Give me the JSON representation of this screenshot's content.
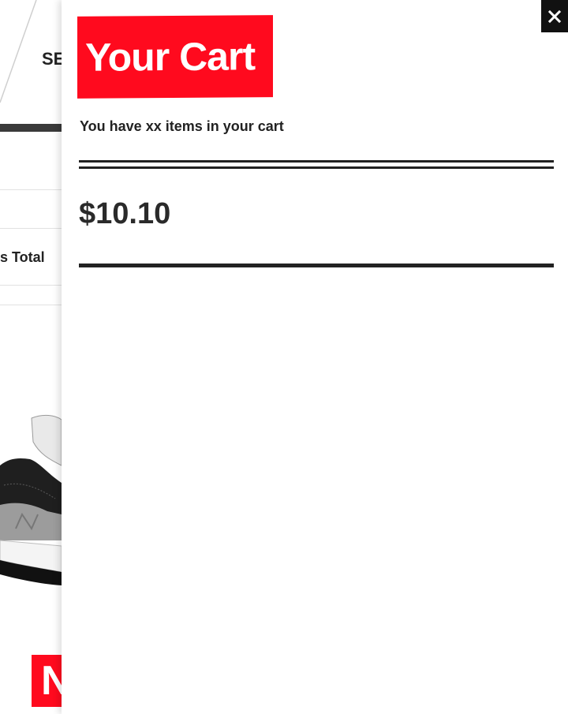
{
  "background_page": {
    "nav_label_partial": "SE",
    "total_label_partial": "s Total",
    "badge_partial": "N",
    "product_image": "sneaker-image"
  },
  "cart": {
    "title": "Your Cart",
    "subtitle": "You have xx items in your cart",
    "total": "$10.10",
    "close_icon": "close-icon"
  },
  "colors": {
    "brand_red": "#ff0a1e",
    "text_dark": "#222222",
    "close_bg": "#111111"
  }
}
